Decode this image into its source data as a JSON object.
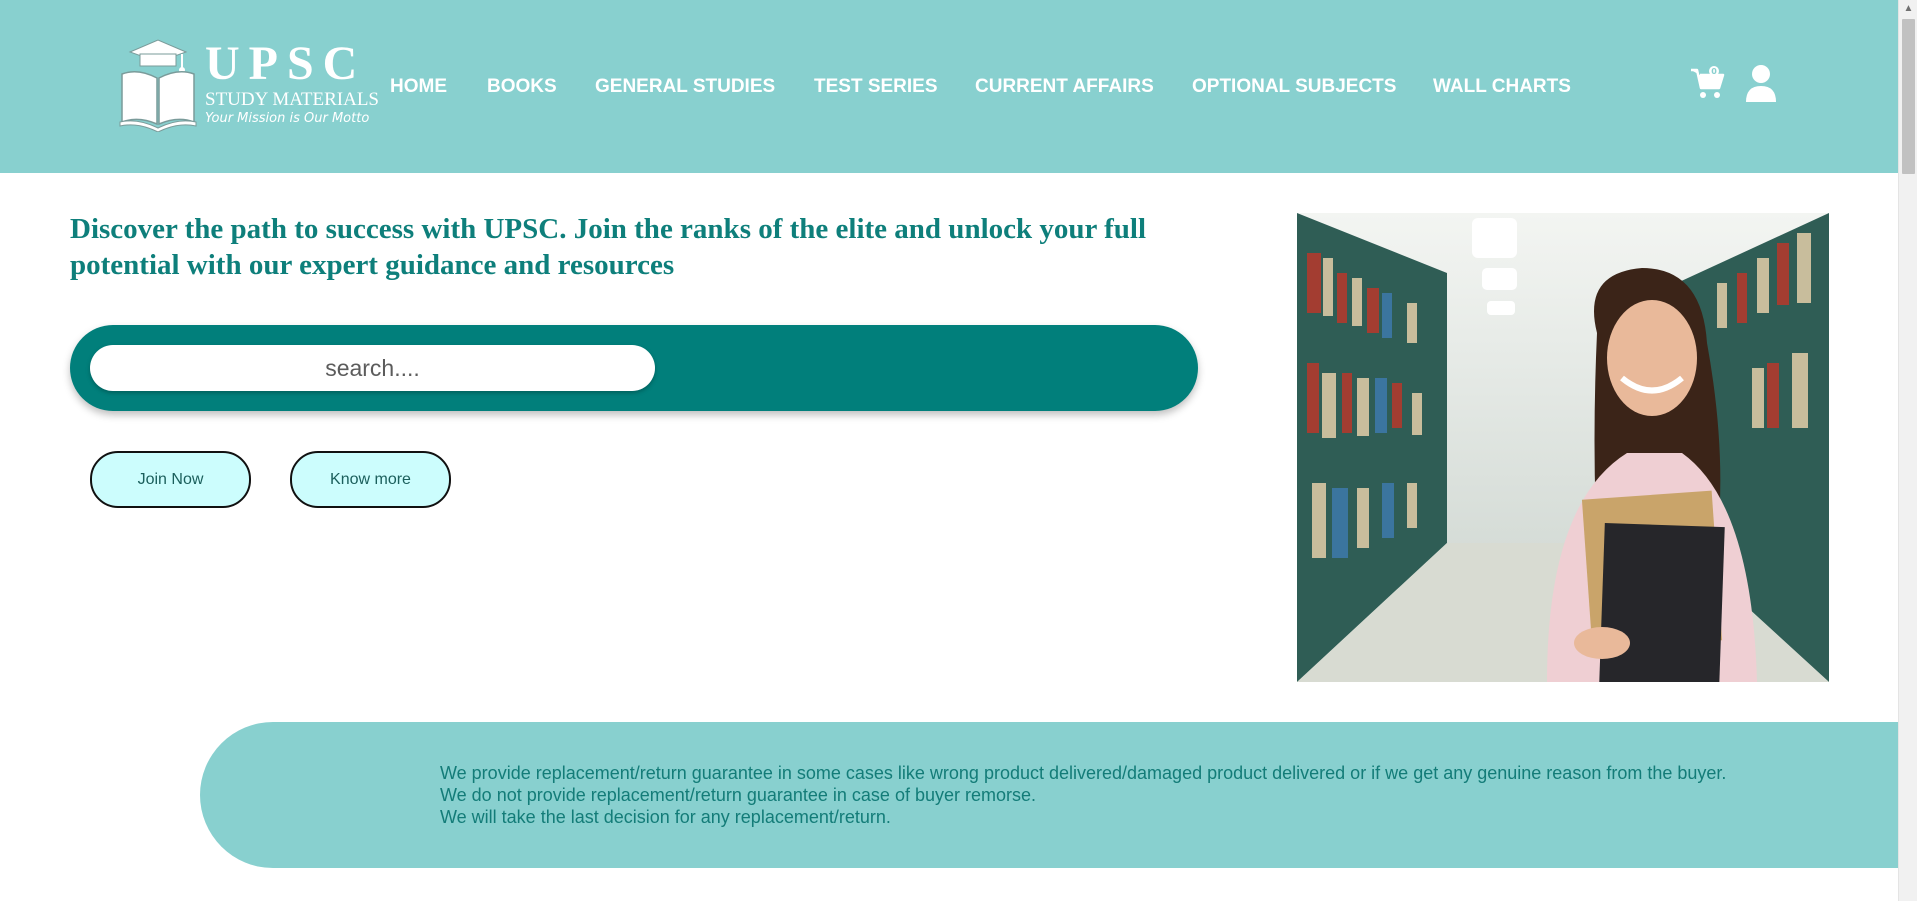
{
  "brand": {
    "title": "UPSC",
    "subtitle": "STUDY MATERIALS",
    "tagline": "Your Mission is Our Motto"
  },
  "nav": {
    "items": [
      {
        "label": "HOME"
      },
      {
        "label": "BOOKS"
      },
      {
        "label": "GENERAL STUDIES"
      },
      {
        "label": "TEST SERIES"
      },
      {
        "label": "CURRENT AFFAIRS"
      },
      {
        "label": "OPTIONAL SUBJECTS"
      },
      {
        "label": "WALL CHARTS"
      }
    ]
  },
  "header_icons": [
    "cart-icon",
    "user-icon"
  ],
  "hero": {
    "heading": "Discover the path to success with UPSC. Join the ranks of the elite and unlock your full potential with our expert guidance and resources",
    "search_placeholder": "search....",
    "buttons": {
      "join": "Join Now",
      "know_more": "Know more"
    }
  },
  "notice": {
    "lines": [
      "We provide replacement/return guarantee in some cases like wrong product delivered/damaged product delivered or if we get any genuine reason from the buyer.",
      "We do not provide replacement/return guarantee in case of buyer remorse.",
      "We will take the last decision for any replacement/return."
    ]
  },
  "colors": {
    "header_bg": "#88d0cf",
    "accent": "#017f7b",
    "heading_text": "#0e7f7b",
    "button_bg": "#ccfdfd"
  }
}
